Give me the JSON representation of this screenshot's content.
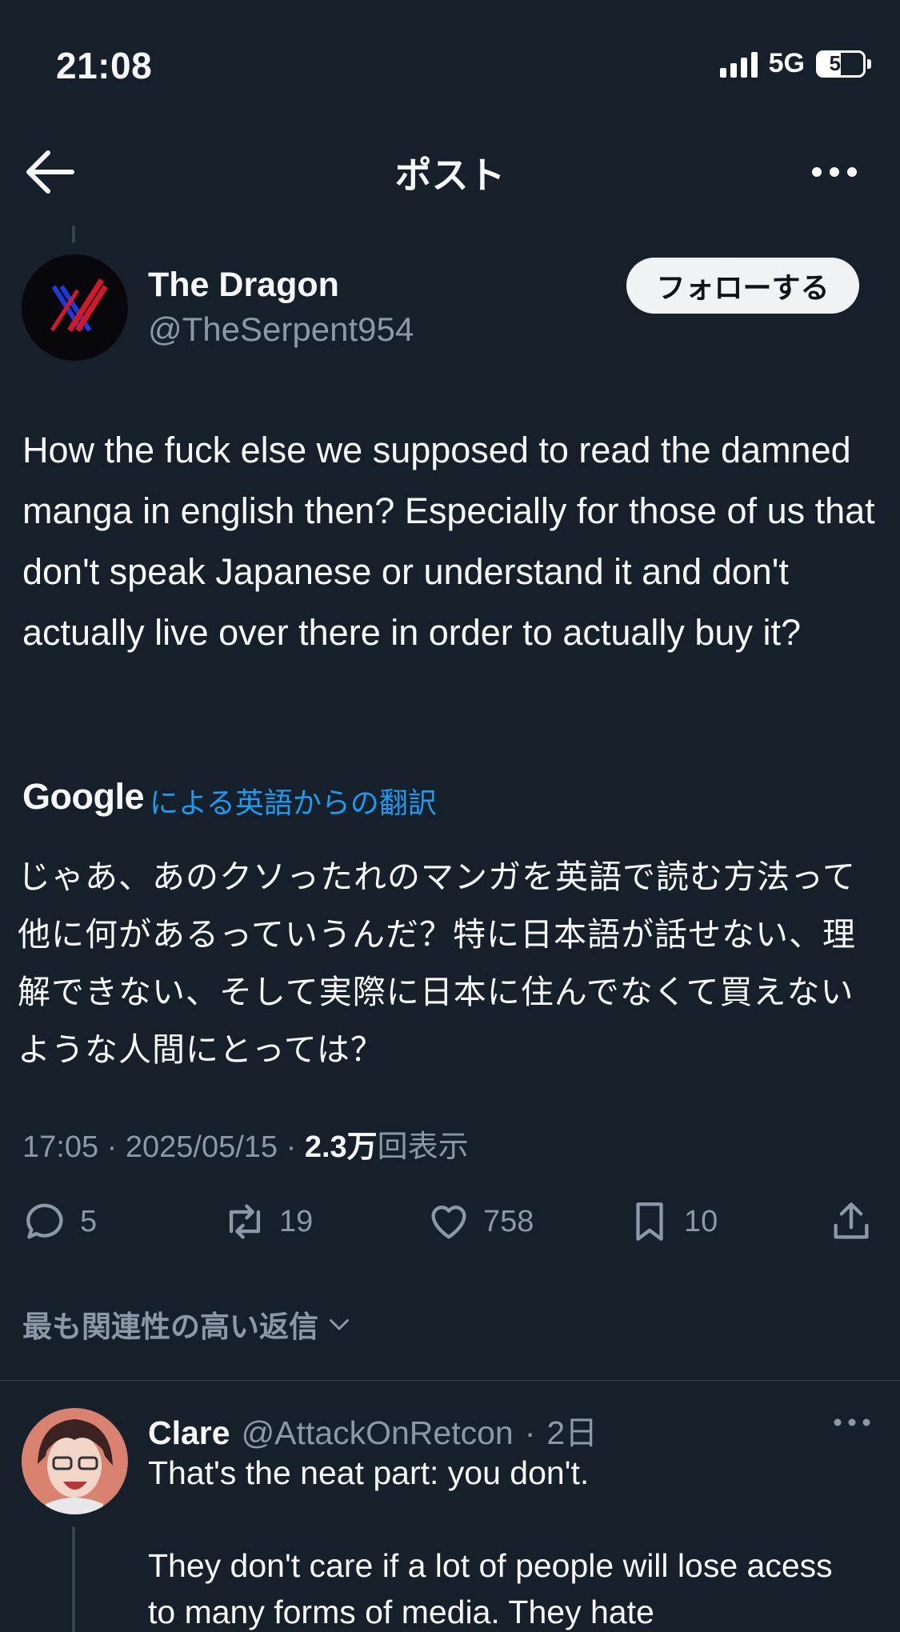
{
  "status_bar": {
    "time": "21:08",
    "network": "5G",
    "battery": "50",
    "battery_level": 0.5
  },
  "header": {
    "title": "ポスト",
    "back_icon": "arrow-left-icon",
    "more_icon": "more-horizontal-icon"
  },
  "post": {
    "author_name": "The Dragon",
    "author_handle": "@TheSerpent954",
    "follow_label": "フォローする",
    "text": "How the fuck else we supposed to read the damned manga in english then? Especially for those of us that don't speak Japanese or understand it and don't actually live over there in order to actually buy it?",
    "translation_provider": "Google",
    "translation_label": "による英語からの翻訳",
    "translated_lines": [
      "じゃあ、あのクソったれのマンガを英語で読む方法って",
      "他に何があるっていうんだ？特に日本語が話せない、理",
      "解できない、そして実際に日本に住んでなくて買えない",
      "ような人間にとっては？"
    ],
    "time": "17:05",
    "date": "2025/05/15",
    "views_count": "2.3万",
    "views_label": "回表示",
    "actions": {
      "replies": "5",
      "reposts": "19",
      "likes": "758",
      "bookmarks": "10"
    }
  },
  "replies_sort": {
    "label": "最も関連性の高い返信"
  },
  "reply": {
    "name": "Clare",
    "handle": "@AttackOnRetcon",
    "time": "2日",
    "paragraphs": [
      "That's the neat part: you don't.",
      "They don't care if a lot of people will lose acess to many forms of media. They hate"
    ]
  },
  "colors": {
    "background": "#15202b",
    "text": "#f7f9f9",
    "secondary_text": "#8b98a5",
    "link": "#1d9bf0",
    "divider": "#38444d",
    "follow_button_bg": "#eff3f4"
  }
}
